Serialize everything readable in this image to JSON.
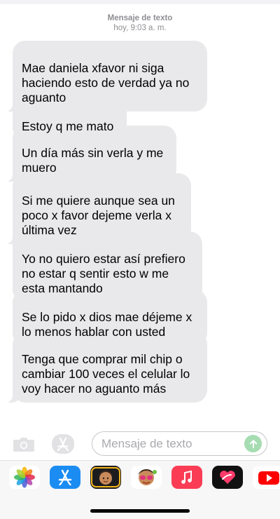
{
  "header": {
    "service_label": "Mensaje de texto",
    "timestamp": "hoy, 9:03 a. m."
  },
  "messages": [
    {
      "text": "Mae daniela xfavor ni siga\nhaciendo esto de verdad ya no\naguanto",
      "direction": "incoming"
    },
    {
      "text": "Estoy q me mato",
      "direction": "incoming"
    },
    {
      "text": "Un día más sin verla y me\nmuero",
      "direction": "incoming"
    },
    {
      "text": "Si me quiere aunque sea un\npoco x favor dejeme  verla x\núltima vez",
      "direction": "incoming"
    },
    {
      "text": "Yo no quiero estar así prefiero\nno estar q sentir esto w me\nesta mantando",
      "direction": "incoming"
    },
    {
      "text": "Se lo pido x dios mae déjeme x\nlo menos hablar con usted",
      "direction": "incoming"
    },
    {
      "text": "Tenga que comprar mil chip o\ncambiar 100 veces el celular lo\nvoy hacer no aguanto más",
      "direction": "incoming"
    }
  ],
  "composer": {
    "placeholder": "Mensaje de texto",
    "value": ""
  },
  "toolbar_icons": [
    "camera-icon",
    "app-store-icon"
  ],
  "app_tray": [
    {
      "name": "photos-app-icon"
    },
    {
      "name": "app-store-app-icon"
    },
    {
      "name": "memoji-app-icon"
    },
    {
      "name": "animoji-app-icon"
    },
    {
      "name": "music-app-icon"
    },
    {
      "name": "digital-touch-app-icon"
    },
    {
      "name": "youtube-app-icon"
    }
  ],
  "colors": {
    "bubble_incoming": "#e9e9eb",
    "send_button": "#a6dcb2",
    "meta_text": "#8e8e93"
  }
}
